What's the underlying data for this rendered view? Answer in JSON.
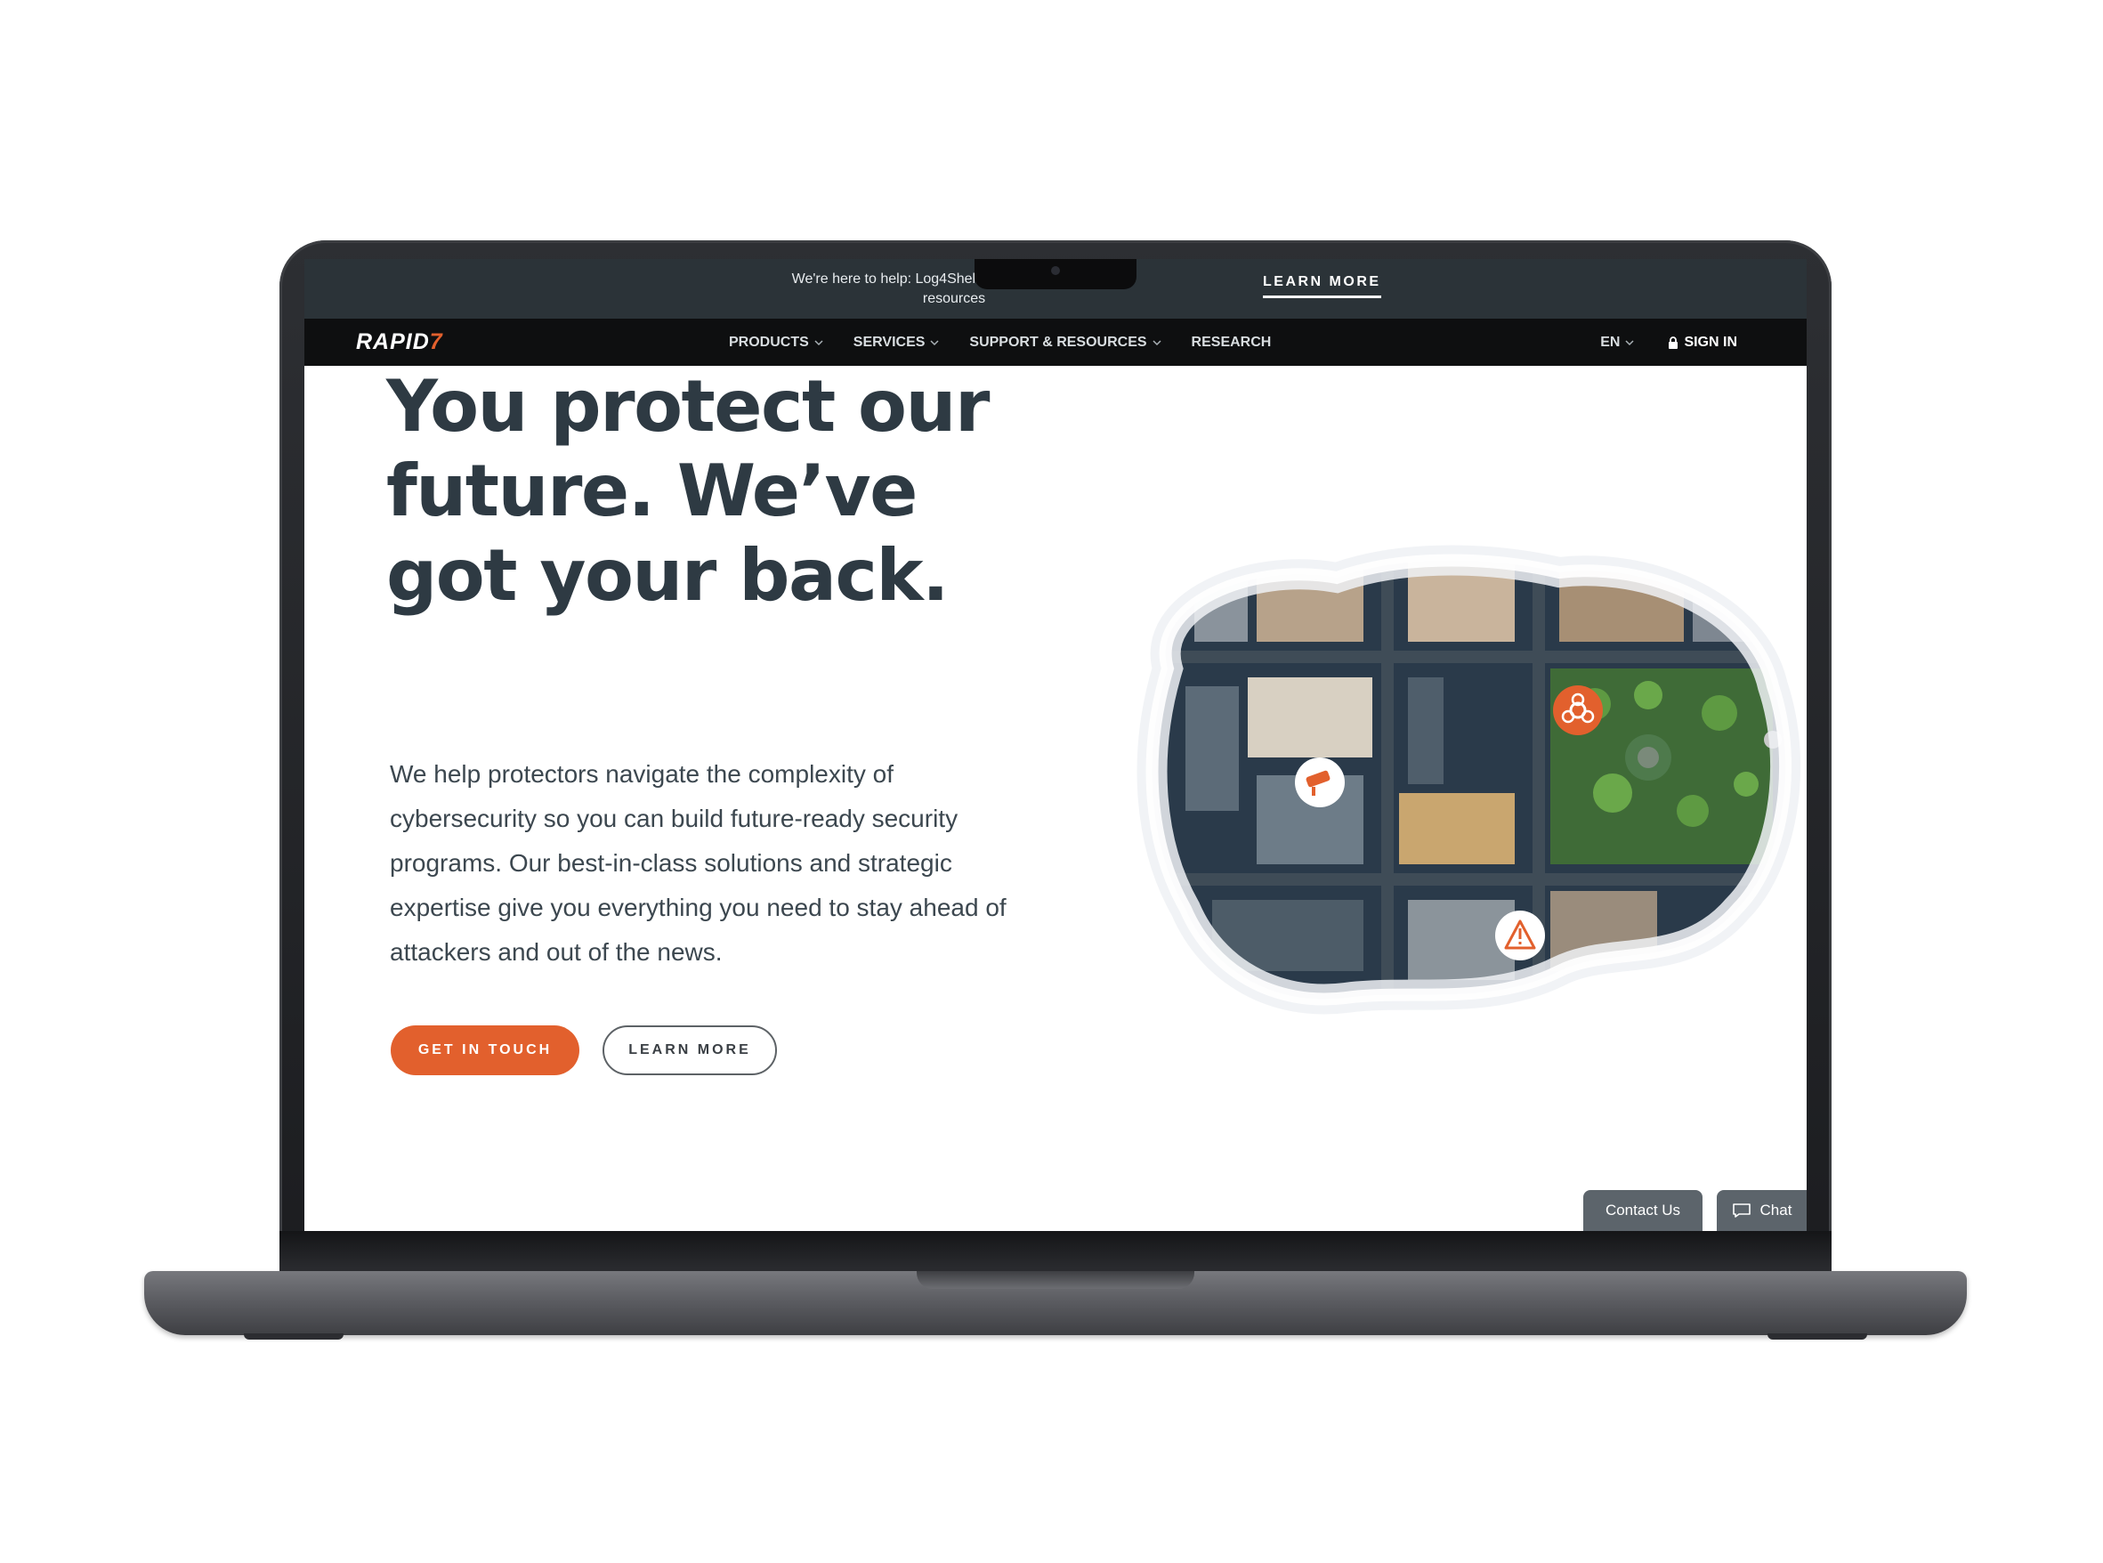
{
  "announcement": {
    "text_line1": "We're here to help: Log4Shell m                          ion",
    "text_line2": "resources",
    "link_label": "LEARN MORE"
  },
  "nav": {
    "logo_text": "RAPID",
    "logo_mark": "7",
    "items": [
      {
        "label": "PRODUCTS",
        "has_dropdown": true
      },
      {
        "label": "SERVICES",
        "has_dropdown": true
      },
      {
        "label": "SUPPORT & RESOURCES",
        "has_dropdown": true
      },
      {
        "label": "RESEARCH",
        "has_dropdown": false
      }
    ],
    "language": "EN",
    "sign_in": "SIGN IN"
  },
  "hero": {
    "headline_lines": [
      "You protect our",
      "future. We’ve",
      "got your back."
    ],
    "lead": "We help protectors navigate the complexity of cybersecurity so you can build future-ready security programs. Our best-in-class solutions and strategic expertise give you everything you need to stay ahead of attackers and out of the news.",
    "primary_cta": "GET IN TOUCH",
    "secondary_cta": "LEARN MORE",
    "illustration_icons": [
      "biohazard-icon",
      "security-camera-icon",
      "warning-icon"
    ]
  },
  "floating": {
    "contact_us": "Contact Us",
    "chat": "Chat"
  },
  "colors": {
    "accent": "#e2602d",
    "announcement_bg": "#2b3338",
    "nav_bg": "#0e0f10",
    "headline": "#2e3a43"
  }
}
